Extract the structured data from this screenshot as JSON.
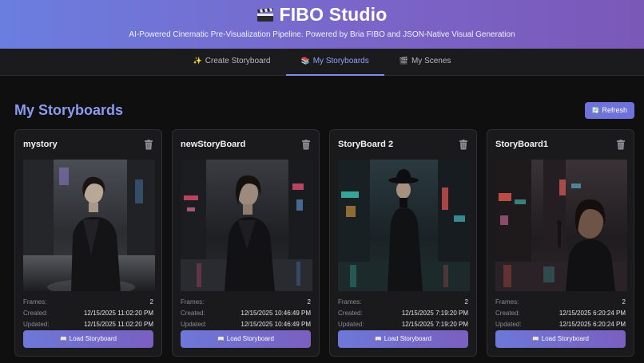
{
  "header": {
    "title": "FIBO Studio",
    "subtitle": "AI-Powered Cinematic Pre-Visualization Pipeline. Powered by Bria FIBO and JSON-Native Visual Generation"
  },
  "tabs": [
    {
      "icon": "✨",
      "label": "Create Storyboard",
      "active": false
    },
    {
      "icon": "📚",
      "label": "My Storyboards",
      "active": true
    },
    {
      "icon": "🎬",
      "label": "My Scenes",
      "active": false
    }
  ],
  "page": {
    "title": "My Storyboards",
    "refresh_icon": "🔄",
    "refresh_label": "Refresh"
  },
  "labels": {
    "frames": "Frames:",
    "created": "Created:",
    "updated": "Updated:",
    "load_icon": "📖",
    "load": "Load Storyboard"
  },
  "colors": {
    "accent": "#8a9cf0",
    "button": "#6f72d8",
    "header_start": "#6a7ee0",
    "header_end": "#7a58b8"
  },
  "storyboards": [
    {
      "name": "mystory",
      "frames": "2",
      "created": "12/15/2025 11:02:20 PM",
      "updated": "12/15/2025 11:02:20 PM"
    },
    {
      "name": "newStoryBoard",
      "frames": "2",
      "created": "12/15/2025 10:46:49 PM",
      "updated": "12/15/2025 10:46:49 PM"
    },
    {
      "name": "StoryBoard 2",
      "frames": "2",
      "created": "12/15/2025 7:19:20 PM",
      "updated": "12/15/2025 7:19:20 PM"
    },
    {
      "name": "StoryBoard1",
      "frames": "2",
      "created": "12/15/2025 6:20:24 PM",
      "updated": "12/15/2025 6:20:24 PM"
    }
  ]
}
